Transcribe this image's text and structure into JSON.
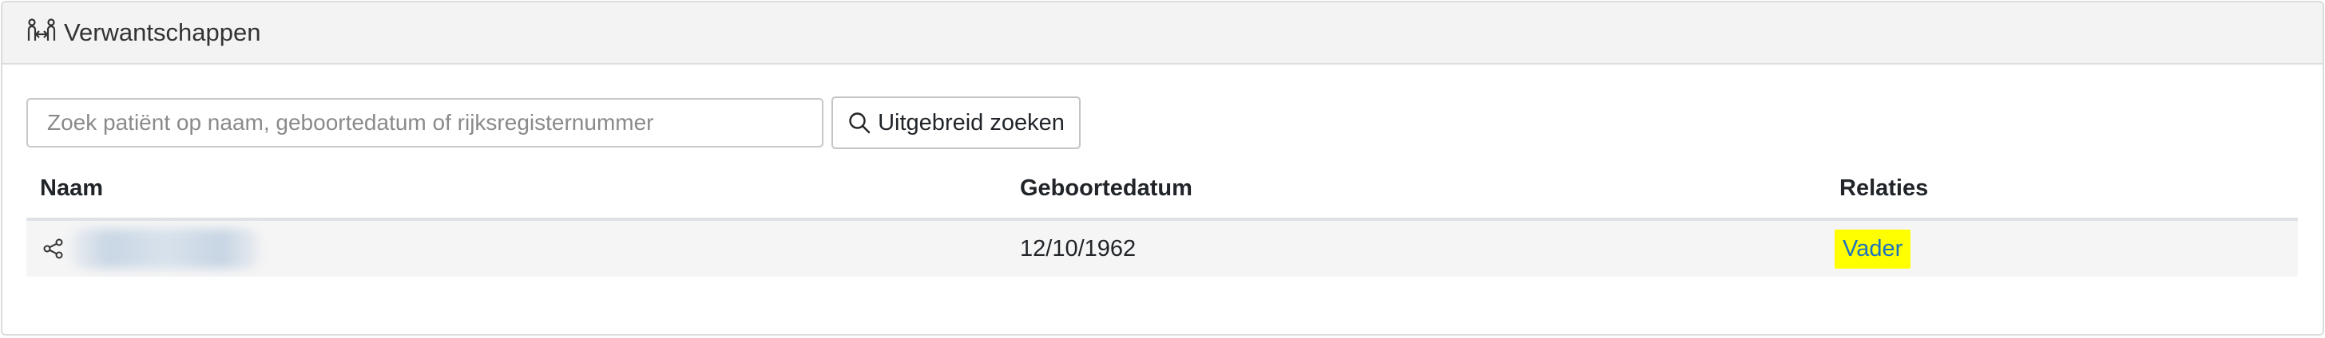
{
  "header": {
    "title": "Verwantschappen",
    "icon": "relationship-icon"
  },
  "search": {
    "placeholder": "Zoek patiënt op naam, geboortedatum of rijksregisternummer",
    "value": "",
    "advanced_label": "Uitgebreid zoeken",
    "advanced_icon": "search-icon"
  },
  "table": {
    "columns": [
      "Naam",
      "Geboortedatum",
      "Relaties"
    ],
    "rows": [
      {
        "name": "",
        "birthdate": "12/10/1962",
        "relation": "Vader",
        "icon": "share-icon"
      }
    ]
  },
  "colors": {
    "highlight": "#ffff00",
    "link": "#1e73be",
    "header_bg": "#f3f3f3",
    "row_bg": "#f5f5f5"
  }
}
